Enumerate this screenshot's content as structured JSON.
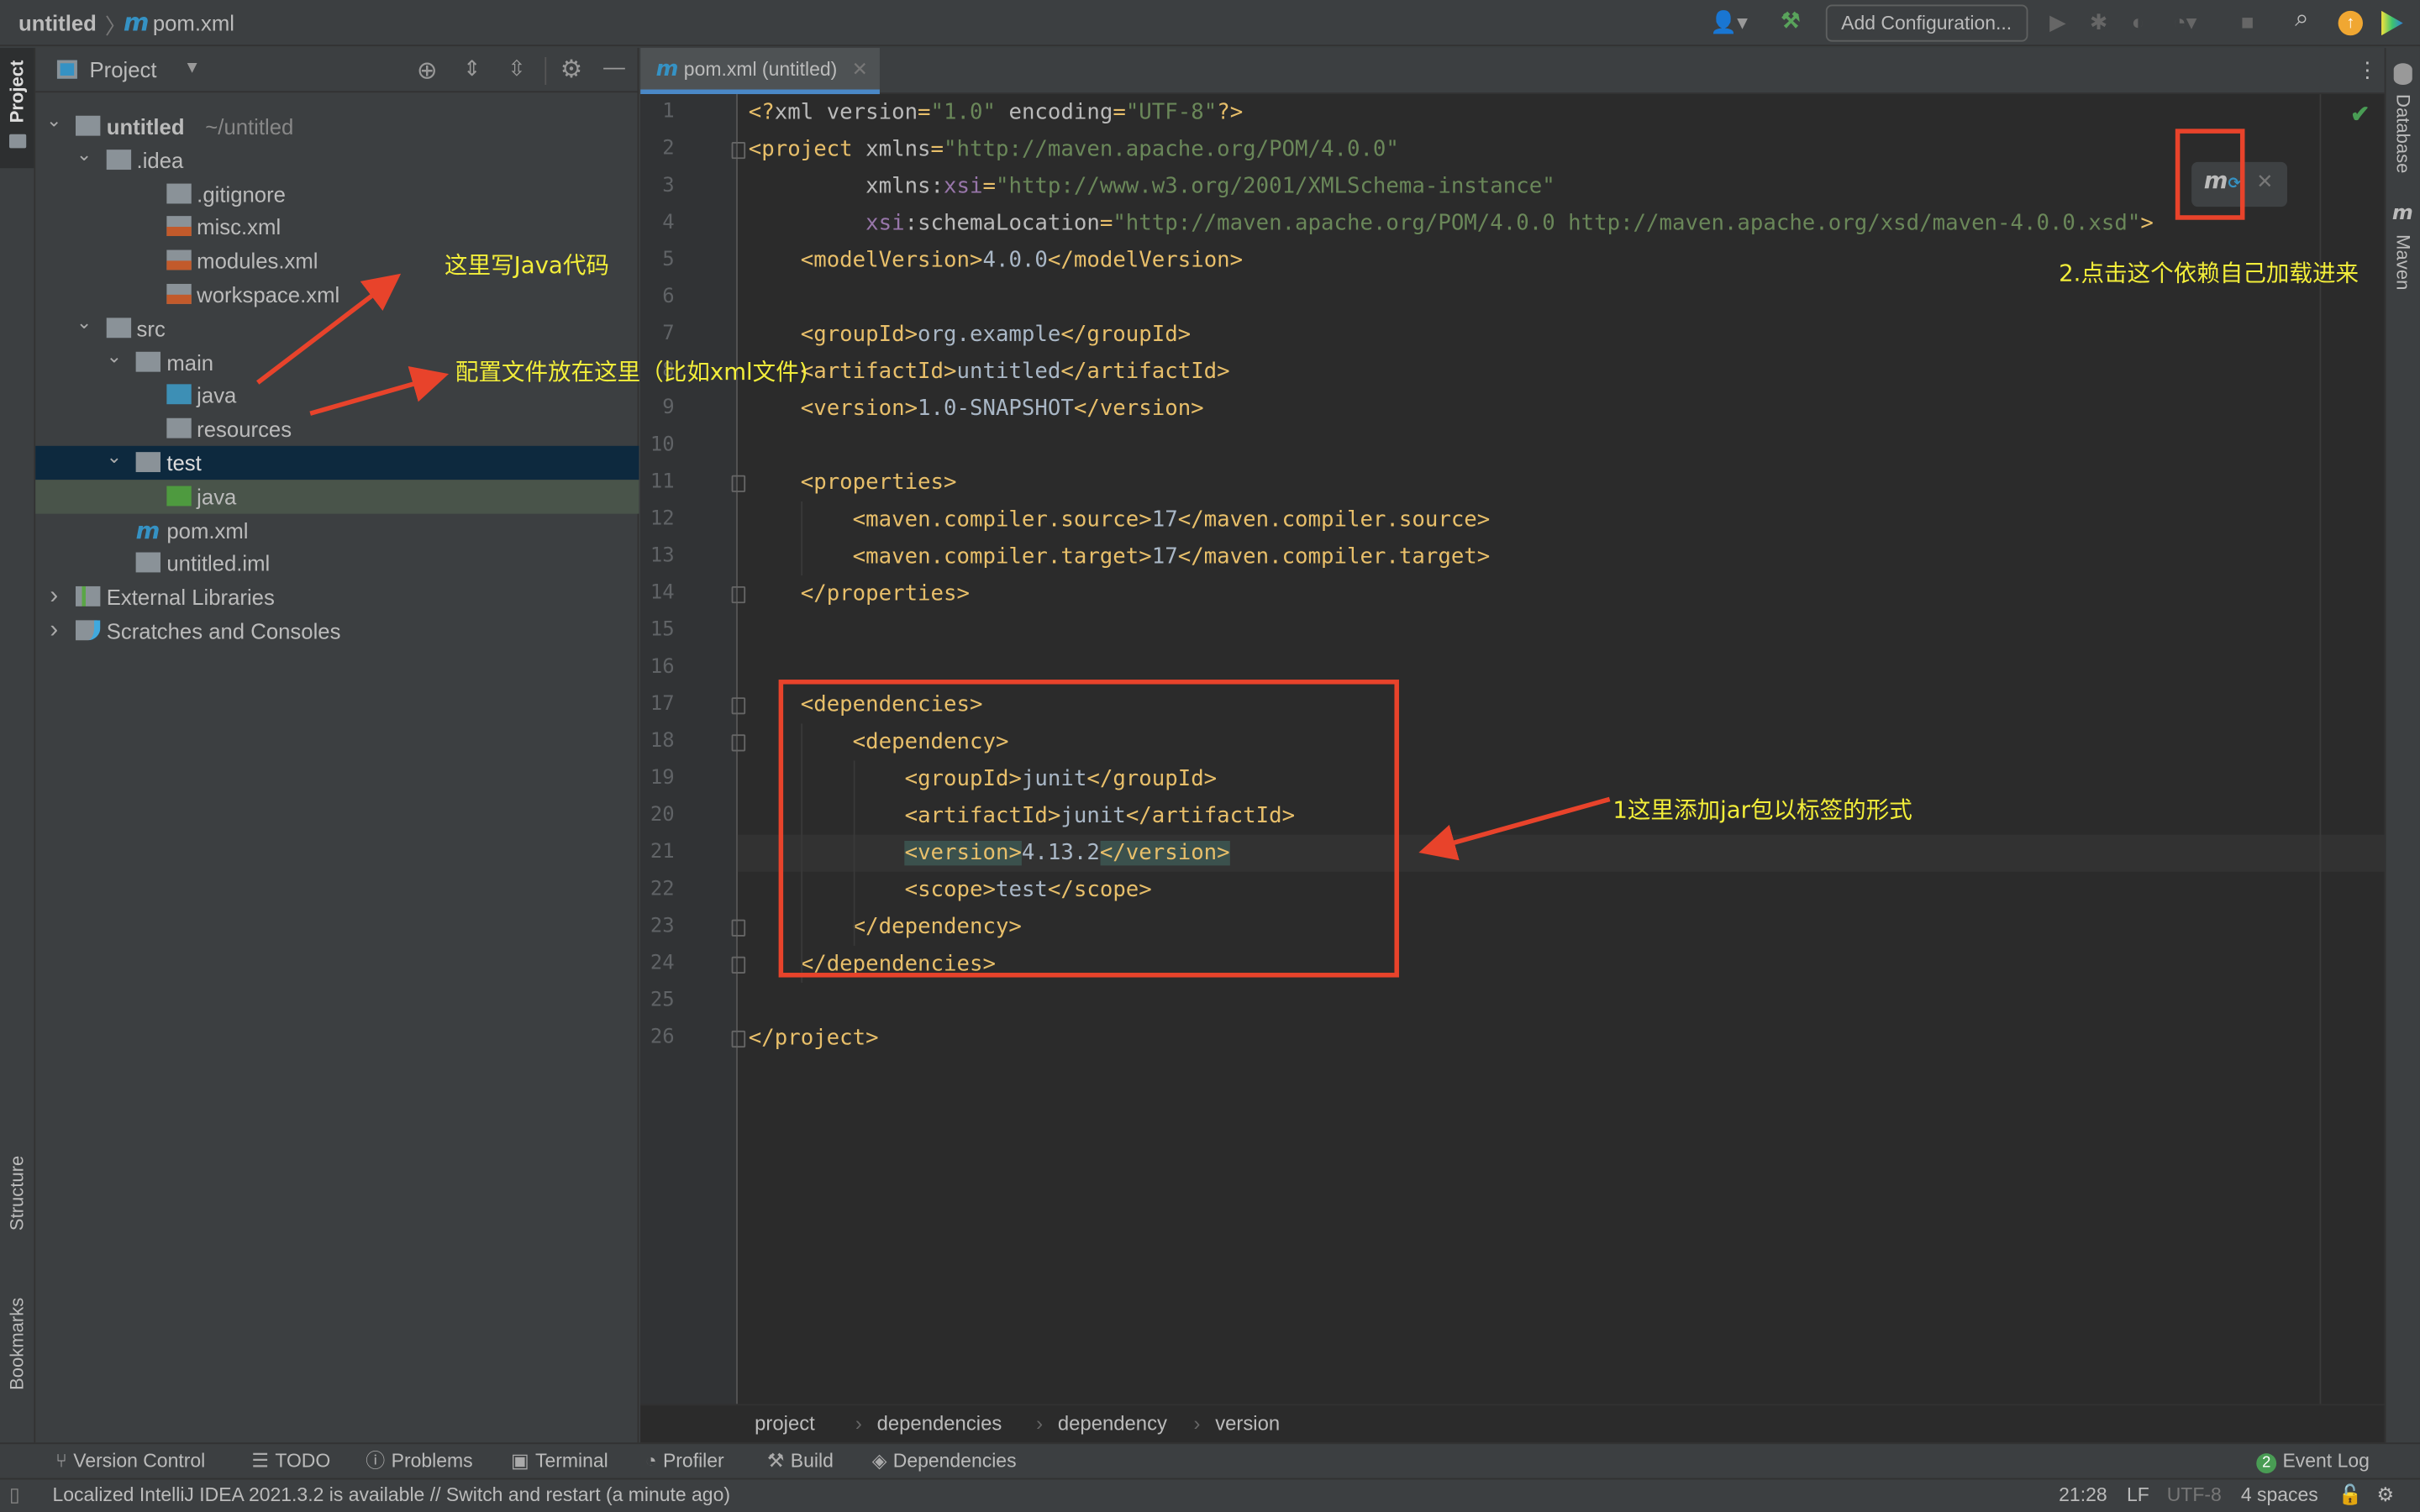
{
  "titlebar": {
    "project": "untitled",
    "file": "pom.xml",
    "add_configuration": "Add Configuration..."
  },
  "project_panel": {
    "title": "Project",
    "tree": [
      {
        "label": "untitled",
        "suffix": "~/untitled",
        "depth": 0,
        "chevron": "down",
        "icon": "module-folder-icon",
        "bold": true
      },
      {
        "label": ".idea",
        "depth": 1,
        "chevron": "down",
        "icon": "folder-icon"
      },
      {
        "label": ".gitignore",
        "depth": 3,
        "icon": "ignore-file-icon"
      },
      {
        "label": "misc.xml",
        "depth": 3,
        "icon": "xml-file-icon"
      },
      {
        "label": "modules.xml",
        "depth": 3,
        "icon": "xml-file-icon"
      },
      {
        "label": "workspace.xml",
        "depth": 3,
        "icon": "xml-file-icon"
      },
      {
        "label": "src",
        "depth": 1,
        "chevron": "down",
        "icon": "folder-icon"
      },
      {
        "label": "main",
        "depth": 2,
        "chevron": "down",
        "icon": "folder-icon"
      },
      {
        "label": "java",
        "depth": 3,
        "icon": "source-folder-icon"
      },
      {
        "label": "resources",
        "depth": 3,
        "icon": "resources-folder-icon"
      },
      {
        "label": "test",
        "depth": 2,
        "chevron": "down",
        "icon": "folder-icon",
        "state": "selected"
      },
      {
        "label": "java",
        "depth": 3,
        "icon": "test-folder-icon",
        "state": "highlighted"
      },
      {
        "label": "pom.xml",
        "depth": 2,
        "icon": "maven-icon"
      },
      {
        "label": "untitled.iml",
        "depth": 2,
        "icon": "iml-file-icon"
      },
      {
        "label": "External Libraries",
        "depth": 0,
        "chevron": "right",
        "icon": "library-icon"
      },
      {
        "label": "Scratches and Consoles",
        "depth": 0,
        "chevron": "right",
        "icon": "scratches-icon"
      }
    ]
  },
  "editor": {
    "tab_label": "pom.xml (untitled)",
    "current_line": 21,
    "lines": [
      [
        [
          "tag",
          "<?"
        ],
        [
          "attr",
          "xml version"
        ],
        [
          "tag",
          "="
        ],
        [
          "val",
          "\"1.0\""
        ],
        [
          "attr",
          " encoding"
        ],
        [
          "tag",
          "="
        ],
        [
          "val",
          "\"UTF-8\""
        ],
        [
          "tag",
          "?>"
        ]
      ],
      [
        [
          "tag",
          "<project "
        ],
        [
          "attr",
          "xmlns"
        ],
        [
          "tag",
          "="
        ],
        [
          "val",
          "\"http://maven.apache.org/POM/4.0.0\""
        ]
      ],
      [
        [
          "txt",
          "         "
        ],
        [
          "attr",
          "xmlns:"
        ],
        [
          "ns",
          "xsi"
        ],
        [
          "tag",
          "="
        ],
        [
          "val",
          "\"http://www.w3.org/2001/XMLSchema-instance\""
        ]
      ],
      [
        [
          "txt",
          "         "
        ],
        [
          "ns",
          "xsi"
        ],
        [
          "attr",
          ":schemaLocation"
        ],
        [
          "tag",
          "="
        ],
        [
          "val",
          "\"http://maven.apache.org/POM/4.0.0 http://maven.apache.org/xsd/maven-4.0.0.xsd\""
        ],
        [
          "tag",
          ">"
        ]
      ],
      [
        [
          "txt",
          "    "
        ],
        [
          "tag",
          "<modelVersion>"
        ],
        [
          "txt",
          "4.0.0"
        ],
        [
          "tag",
          "</modelVersion>"
        ]
      ],
      [],
      [
        [
          "txt",
          "    "
        ],
        [
          "tag",
          "<groupId>"
        ],
        [
          "txt",
          "org.example"
        ],
        [
          "tag",
          "</groupId>"
        ]
      ],
      [
        [
          "txt",
          "    "
        ],
        [
          "tag",
          "<artifactId>"
        ],
        [
          "txt",
          "untitled"
        ],
        [
          "tag",
          "</artifactId>"
        ]
      ],
      [
        [
          "txt",
          "    "
        ],
        [
          "tag",
          "<version>"
        ],
        [
          "txt",
          "1.0-SNAPSHOT"
        ],
        [
          "tag",
          "</version>"
        ]
      ],
      [],
      [
        [
          "txt",
          "    "
        ],
        [
          "tag",
          "<properties>"
        ]
      ],
      [
        [
          "txt",
          "        "
        ],
        [
          "tag",
          "<maven.compiler.source>"
        ],
        [
          "txt",
          "17"
        ],
        [
          "tag",
          "</maven.compiler.source>"
        ]
      ],
      [
        [
          "txt",
          "        "
        ],
        [
          "tag",
          "<maven.compiler.target>"
        ],
        [
          "txt",
          "17"
        ],
        [
          "tag",
          "</maven.compiler.target>"
        ]
      ],
      [
        [
          "txt",
          "    "
        ],
        [
          "tag",
          "</properties>"
        ]
      ],
      [],
      [],
      [
        [
          "txt",
          "    "
        ],
        [
          "tag",
          "<dependencies>"
        ]
      ],
      [
        [
          "txt",
          "        "
        ],
        [
          "tag",
          "<dependency>"
        ]
      ],
      [
        [
          "txt",
          "            "
        ],
        [
          "tag",
          "<groupId>"
        ],
        [
          "txt",
          "junit"
        ],
        [
          "tag",
          "</groupId>"
        ]
      ],
      [
        [
          "txt",
          "            "
        ],
        [
          "tag",
          "<artifactId>"
        ],
        [
          "txt",
          "junit"
        ],
        [
          "tag",
          "</artifactId>"
        ]
      ],
      [
        [
          "txt",
          "            "
        ],
        [
          "tag hl",
          "<version>"
        ],
        [
          "txt",
          "4.13.2"
        ],
        [
          "tag hl",
          "</version>"
        ]
      ],
      [
        [
          "txt",
          "            "
        ],
        [
          "tag",
          "<scope>"
        ],
        [
          "txt",
          "test"
        ],
        [
          "tag",
          "</scope>"
        ]
      ],
      [
        [
          "txt",
          "        "
        ],
        [
          "tag",
          "</dependency>"
        ]
      ],
      [
        [
          "txt",
          "    "
        ],
        [
          "tag",
          "</dependencies>"
        ]
      ],
      [],
      [
        [
          "tag",
          "</project>"
        ]
      ]
    ],
    "breadcrumb": [
      "project",
      "dependencies",
      "dependency",
      "version"
    ]
  },
  "side_tabs": {
    "left_top": "Project",
    "left_structure": "Structure",
    "left_bookmarks": "Bookmarks",
    "right_database": "Database",
    "right_maven": "Maven"
  },
  "tool_windows": [
    "Version Control",
    "TODO",
    "Problems",
    "Terminal",
    "Profiler",
    "Build",
    "Dependencies"
  ],
  "event_log": {
    "label": "Event Log",
    "count": "2"
  },
  "status": {
    "message": "Localized IntelliJ IDEA 2021.3.2 is available // Switch and restart (a minute ago)",
    "position": "21:28",
    "line_sep": "LF",
    "encoding": "UTF-8",
    "indent": "4 spaces"
  },
  "annotations": {
    "java_note": "这里写Java代码",
    "resources_note": "配置文件放在这里（比如xml文件)",
    "dependency_note": "1这里添加jar包以标签的形式",
    "maven_note": "2.点击这个依赖自己加载进来"
  },
  "colors": {
    "annotation_red": "#e8432b",
    "annotation_yellow": "#f3ee3a",
    "accent": "#4a88c7",
    "selection": "#0d293e"
  }
}
